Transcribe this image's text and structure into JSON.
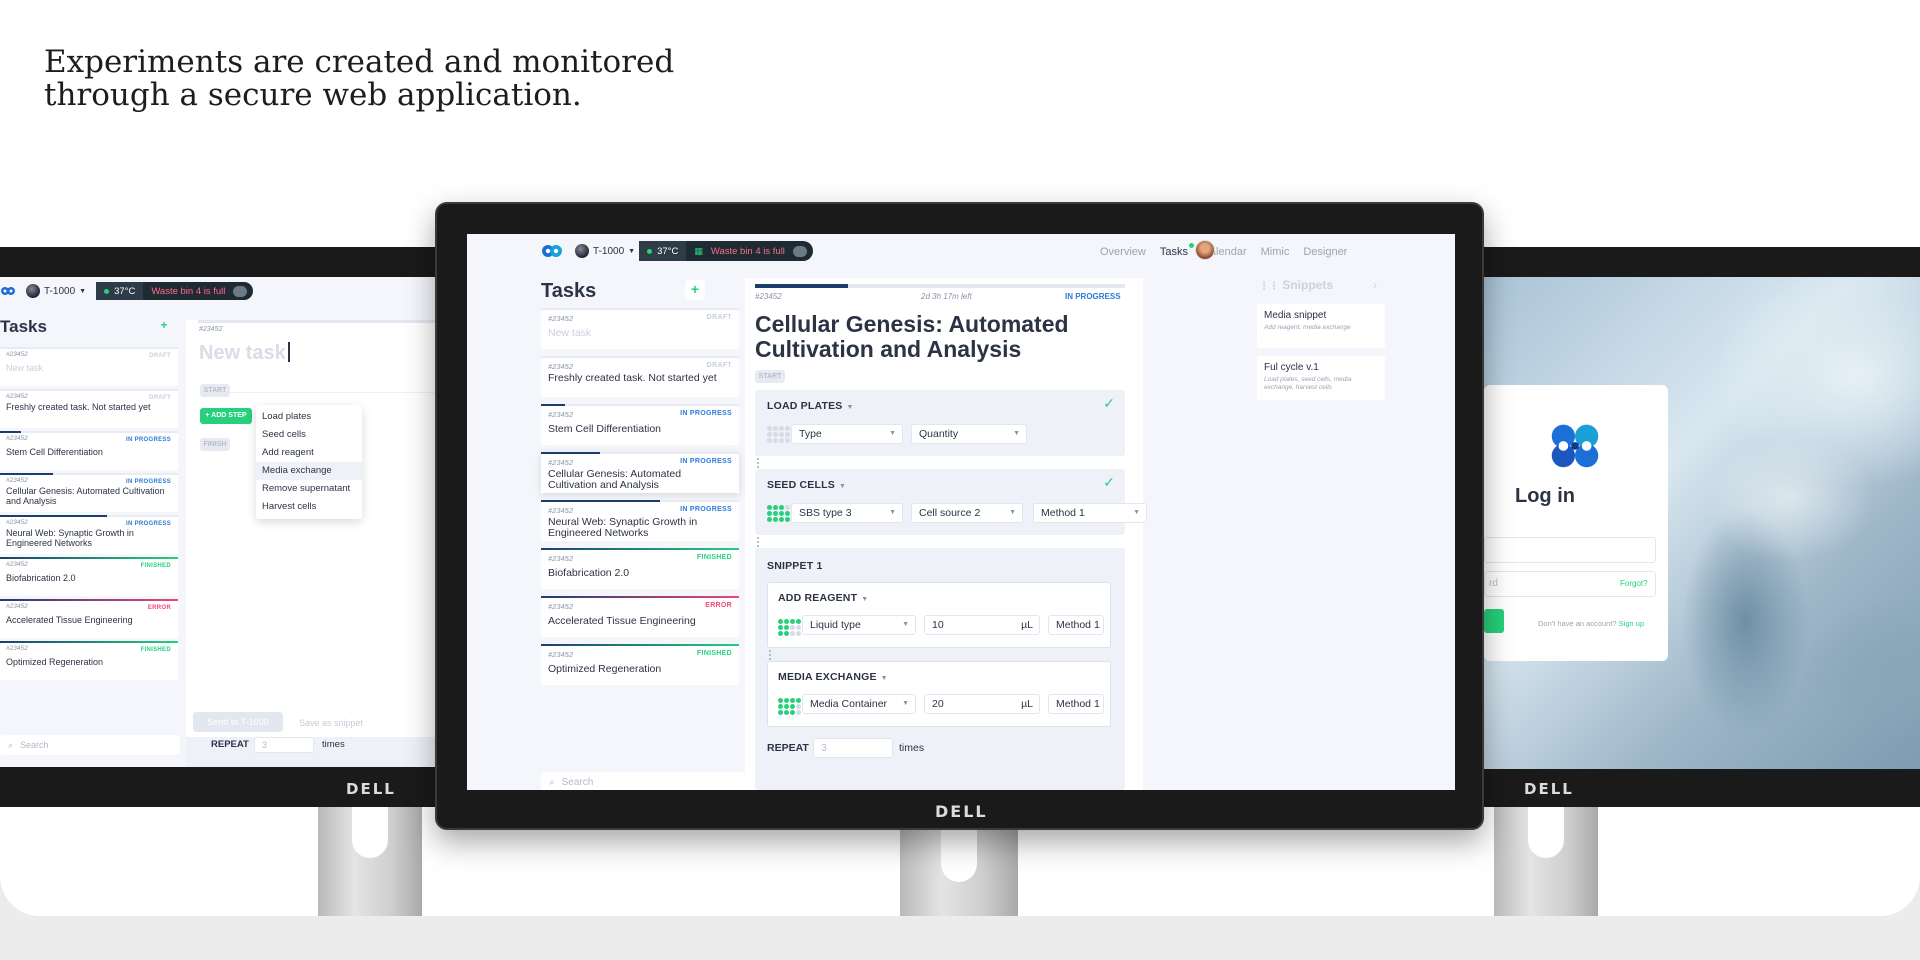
{
  "headline": "Experiments are created and monitored\nthrough a secure web application.",
  "brand": "DELL",
  "colors": {
    "accent_green": "#26d07c",
    "progress_blue": "#2a7bd6",
    "error_pink": "#f0467a",
    "navy": "#1c3e6e"
  },
  "app": {
    "device": "T-1000",
    "temperature": "37°C",
    "warning": "Waste bin 4 is full",
    "nav": [
      "Overview",
      "Tasks",
      "Calendar",
      "Mimic",
      "Designer"
    ],
    "nav_active": "Tasks",
    "tasks_title": "Tasks",
    "add_icon": "plus-icon",
    "search_placeholder": "Search"
  },
  "tasks": [
    {
      "id": "#23452",
      "status": "DRAFT",
      "name": "New task",
      "progress": 0,
      "color": "#c9cfdb",
      "placeholder": true
    },
    {
      "id": "#23452",
      "status": "DRAFT",
      "name": "Freshly created task. Not started yet",
      "progress": 0,
      "color": "#c9cfdb"
    },
    {
      "id": "#23452",
      "status": "IN PROGRESS",
      "name": "Stem Cell Differentiation",
      "progress": 0.12,
      "color": "#2a7bd6"
    },
    {
      "id": "#23452",
      "status": "IN PROGRESS",
      "name": "Cellular Genesis: Automated Cultivation and Analysis",
      "progress": 0.3,
      "color": "#2a7bd6"
    },
    {
      "id": "#23452",
      "status": "IN PROGRESS",
      "name": "Neural Web: Synaptic Growth in Engineered Networks",
      "progress": 0.6,
      "color": "#2a7bd6"
    },
    {
      "id": "#23452",
      "status": "FINISHED",
      "name": "Biofabrication 2.0",
      "progress": 1,
      "color": "#26d07c"
    },
    {
      "id": "#23452",
      "status": "ERROR",
      "name": "Accelerated Tissue Engineering",
      "progress": 1,
      "color": "#f0467a"
    },
    {
      "id": "#23452",
      "status": "FINISHED",
      "name": "Optimized Regeneration",
      "progress": 1,
      "color": "#26d07c"
    }
  ],
  "detail": {
    "id": "#23452",
    "time_left": "2d 3h 17m left",
    "status": "IN PROGRESS",
    "progress": 0.25,
    "title": "Cellular Genesis: Automated Cultivation and Analysis",
    "start_label": "START",
    "steps": {
      "load_plates": {
        "title": "LOAD PLATES",
        "type": "Type",
        "quantity": "Quantity"
      },
      "seed_cells": {
        "title": "SEED CELLS",
        "plate": "SBS type 3",
        "source": "Cell source 2",
        "method": "Method 1"
      },
      "snippet": {
        "title": "SNIPPET 1"
      },
      "add_reagent": {
        "title": "ADD REAGENT",
        "liquid": "Liquid type",
        "volume": "10",
        "unit": "µL",
        "method": "Method 1"
      },
      "media_exchange": {
        "title": "MEDIA EXCHANGE",
        "container": "Media Container",
        "volume": "20",
        "unit": "µL",
        "method": "Method 1"
      },
      "repeat": {
        "label": "REPEAT",
        "placeholder": "3",
        "suffix": "times"
      }
    }
  },
  "snippets": {
    "title": "Snippets",
    "items": [
      {
        "name": "Media snippet",
        "desc": "Add reagent, media exchange"
      },
      {
        "name": "Ful cycle v.1",
        "desc": "Load plates, seed cells, media exchange, harvest cells"
      }
    ]
  },
  "left_editor": {
    "id": "#23452",
    "placeholder": "New task",
    "start": "START",
    "add_step": "+ ADD STEP",
    "finish": "FINISH",
    "menu": [
      "Load plates",
      "Seed cells",
      "Add reagent",
      "Media exchange",
      "Remove supernatant",
      "Harvest cells"
    ],
    "menu_highlight": 3,
    "send": "Send to T-1000",
    "save_snippet": "Save as snippet",
    "repeat": "REPEAT",
    "repeat_placeholder": "3",
    "times": "times"
  },
  "login": {
    "title": "Log in",
    "password_fragment": "rd",
    "forgot": "Forgot?",
    "no_account": "Don't have an account?",
    "sign_up": "Sign up"
  }
}
